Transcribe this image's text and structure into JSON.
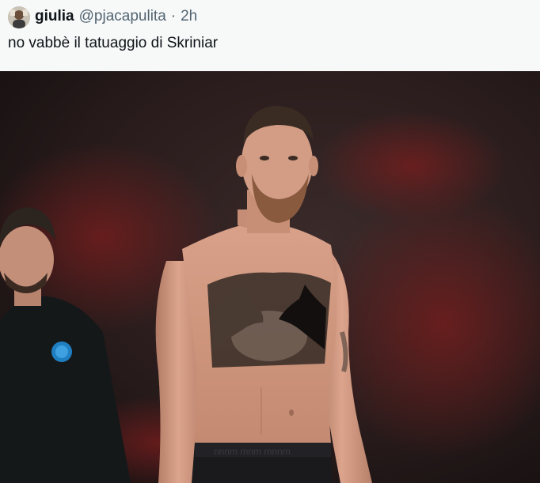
{
  "tweet": {
    "author_name": "giulia",
    "author_handle": "@pjacapulita",
    "separator": "·",
    "time": "2h",
    "text": "no vabbè il tatuaggio di Skriniar"
  },
  "media": {
    "kind": "photo",
    "icon": "tweet-photo"
  }
}
